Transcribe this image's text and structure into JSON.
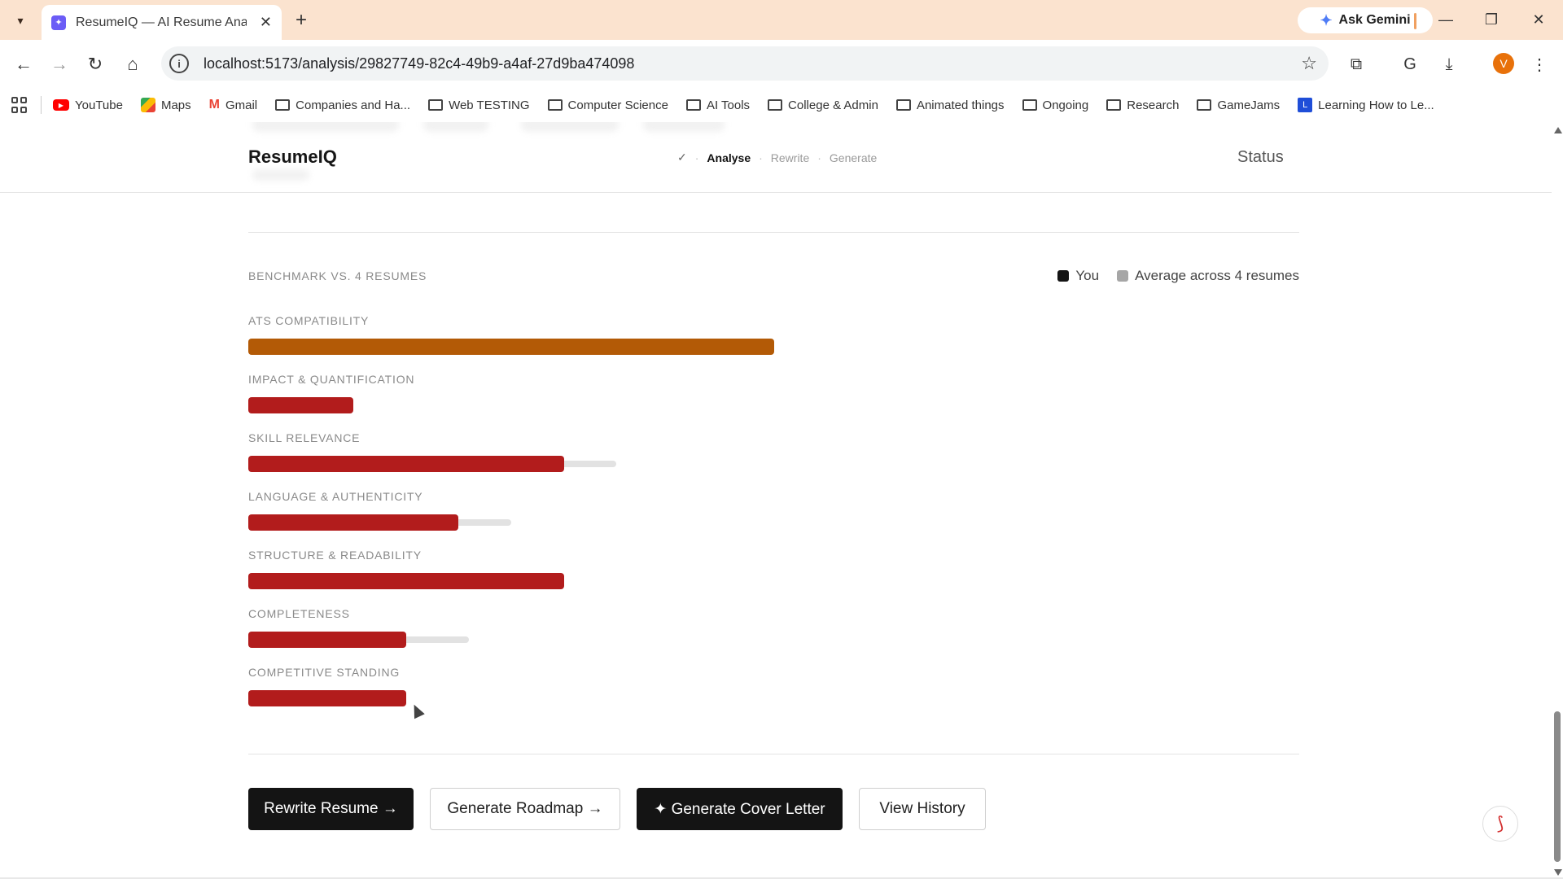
{
  "browser": {
    "tab_title": "ResumeIQ — AI Resume Analys",
    "tab_favicon": "✦",
    "ask_gemini": "Ask Gemini",
    "url": "localhost:5173/analysis/29827749-82c4-49b9-a4af-27d9ba474098",
    "profile_initial": "V",
    "bookmarks": [
      {
        "label": "YouTube",
        "icon": "youtube-icon"
      },
      {
        "label": "Maps",
        "icon": "maps-icon"
      },
      {
        "label": "Gmail",
        "icon": "gmail-icon"
      },
      {
        "label": "Companies and Ha...",
        "icon": "folder-icon"
      },
      {
        "label": "Web TESTING",
        "icon": "folder-icon"
      },
      {
        "label": "Computer Science",
        "icon": "folder-icon"
      },
      {
        "label": "AI Tools",
        "icon": "folder-icon"
      },
      {
        "label": "College & Admin",
        "icon": "folder-icon"
      },
      {
        "label": "Animated things",
        "icon": "folder-icon"
      },
      {
        "label": "Ongoing",
        "icon": "folder-icon"
      },
      {
        "label": "Research",
        "icon": "folder-icon"
      },
      {
        "label": "GameJams",
        "icon": "folder-icon"
      },
      {
        "label": "Learning How to Le...",
        "icon": "learning-icon"
      }
    ]
  },
  "app": {
    "brand": "ResumeIQ",
    "steps": {
      "check": "✓",
      "analyse": "Analyse",
      "rewrite": "Rewrite",
      "generate": "Generate"
    },
    "status_link": "Status"
  },
  "benchmark": {
    "title": "BENCHMARK VS. 4 RESUMES",
    "legend_you": "You",
    "legend_avg": "Average across 4 resumes",
    "colors": {
      "you_legend": "#141414",
      "avg_legend": "#a6a6a6",
      "orange": "#b35a06",
      "red": "#b21c1c",
      "avg_track": "#e2e2e2"
    },
    "metrics": [
      {
        "label": "ATS COMPATIBILITY",
        "you": 100,
        "avg": 100,
        "color": "orange"
      },
      {
        "label": "IMPACT & QUANTIFICATION",
        "you": 20,
        "avg": 20,
        "color": "red"
      },
      {
        "label": "SKILL RELEVANCE",
        "you": 60,
        "avg": 70,
        "color": "red"
      },
      {
        "label": "LANGUAGE & AUTHENTICITY",
        "you": 40,
        "avg": 50,
        "color": "red"
      },
      {
        "label": "STRUCTURE & READABILITY",
        "you": 60,
        "avg": 60,
        "color": "red"
      },
      {
        "label": "COMPLETENESS",
        "you": 30,
        "avg": 42,
        "color": "red"
      },
      {
        "label": "COMPETITIVE STANDING",
        "you": 30,
        "avg": 30,
        "color": "red"
      }
    ]
  },
  "actions": {
    "rewrite": "Rewrite Resume →",
    "roadmap": "Generate Roadmap →",
    "cover_letter": "✦ Generate Cover Letter",
    "history": "View History"
  }
}
